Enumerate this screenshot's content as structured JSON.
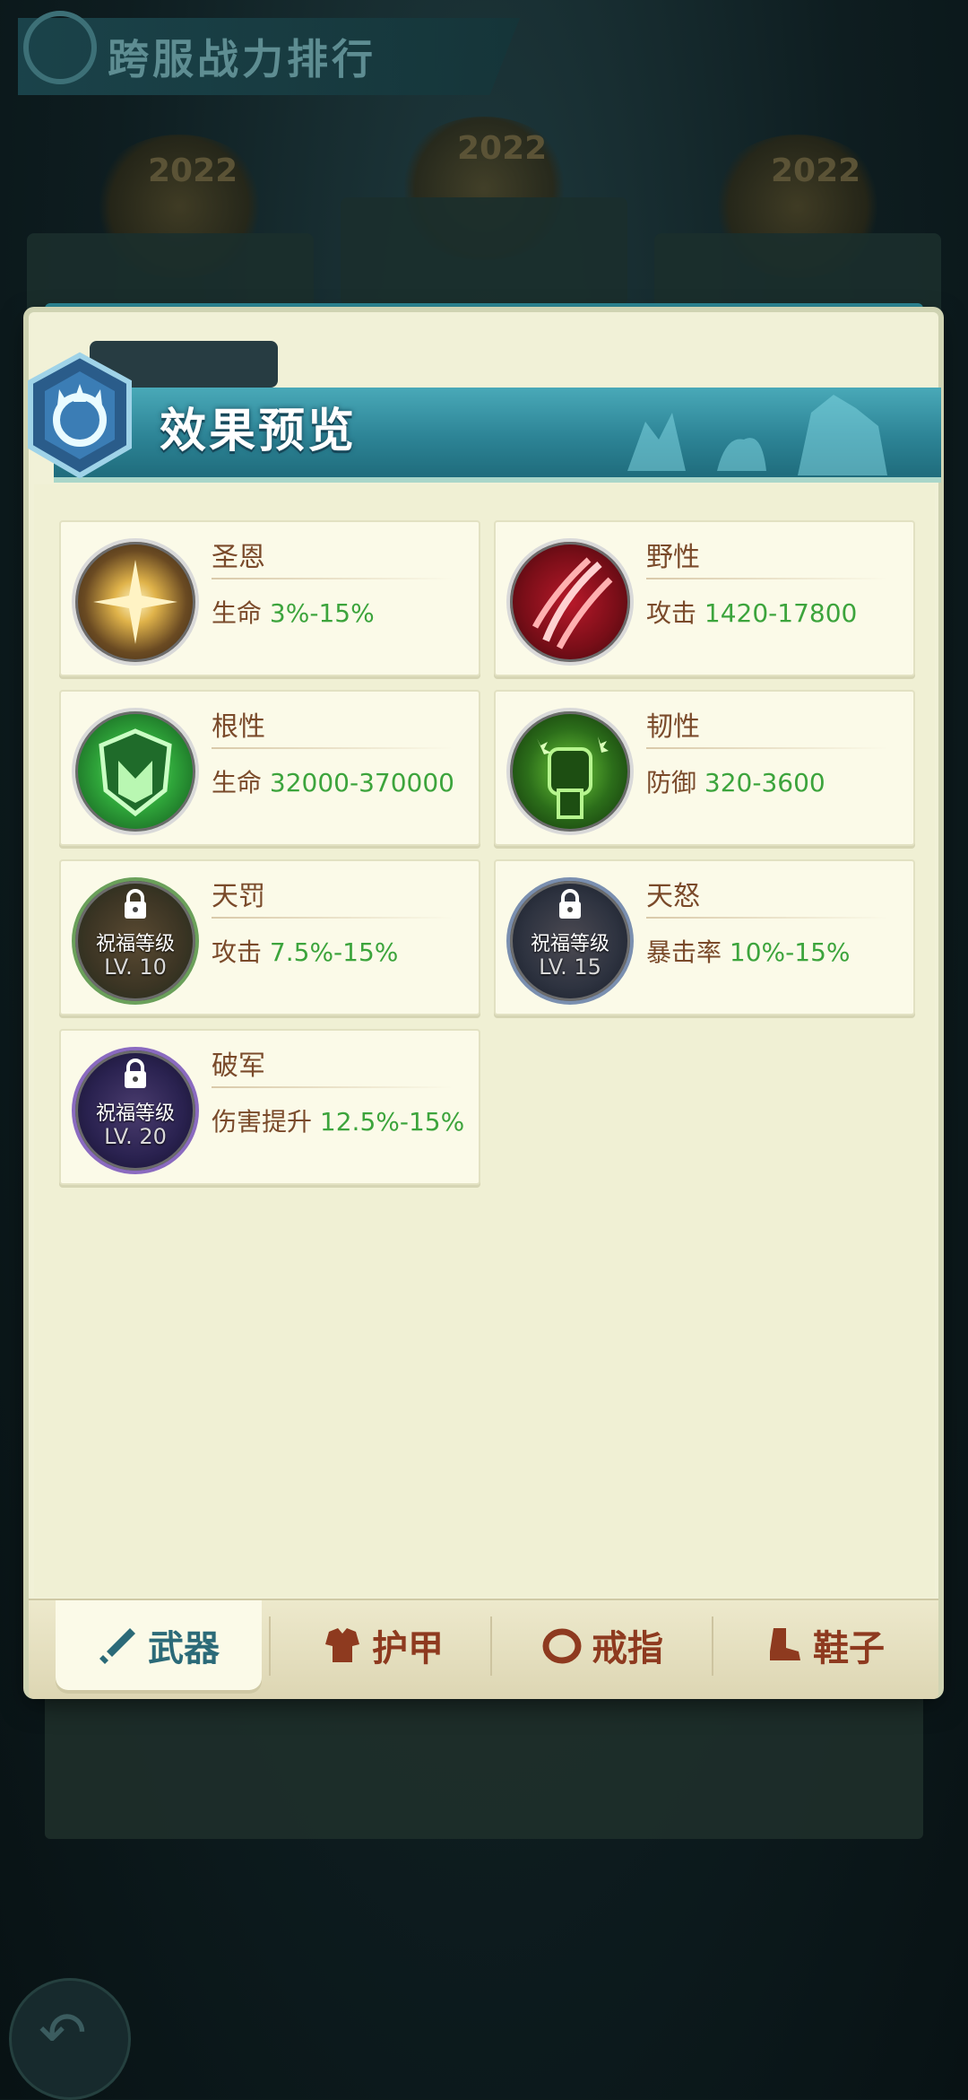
{
  "background": {
    "banner_title": "跨服战力排行",
    "year_badges": [
      "2022",
      "2022",
      "2022"
    ]
  },
  "header": {
    "title": "效果预览"
  },
  "effects": [
    {
      "name": "圣恩",
      "label": "生命",
      "value": "3%-15%",
      "icon": "radiant-star-icon",
      "locked": false
    },
    {
      "name": "野性",
      "label": "攻击",
      "value": "1420-17800",
      "icon": "claw-slash-icon",
      "locked": false
    },
    {
      "name": "根性",
      "label": "生命",
      "value": "32000-370000",
      "icon": "green-shield-icon",
      "locked": false
    },
    {
      "name": "韧性",
      "label": "防御",
      "value": "320-3600",
      "icon": "green-fist-icon",
      "locked": false
    },
    {
      "name": "天罚",
      "label": "攻击",
      "value": "7.5%-15%",
      "icon": "lock-icon",
      "locked": true,
      "lock_text": "祝福等级",
      "lock_level": "LV. 10"
    },
    {
      "name": "天怒",
      "label": "暴击率",
      "value": "10%-15%",
      "icon": "lock-icon",
      "locked": true,
      "lock_text": "祝福等级",
      "lock_level": "LV. 15"
    },
    {
      "name": "破军",
      "label": "伤害提升",
      "value": "12.5%-15%",
      "icon": "lock-icon",
      "locked": true,
      "lock_text": "祝福等级",
      "lock_level": "LV. 20"
    }
  ],
  "tabs": [
    {
      "label": "武器",
      "icon": "sword-icon",
      "active": true
    },
    {
      "label": "护甲",
      "icon": "armor-icon",
      "active": false
    },
    {
      "label": "戒指",
      "icon": "ring-icon",
      "active": false
    },
    {
      "label": "鞋子",
      "icon": "boot-icon",
      "active": false
    }
  ],
  "colors": {
    "value_green": "#3ca43c",
    "label_brown": "#7a4a2a",
    "header_teal": "#2d8496",
    "panel_cream": "#f0f0d4"
  }
}
